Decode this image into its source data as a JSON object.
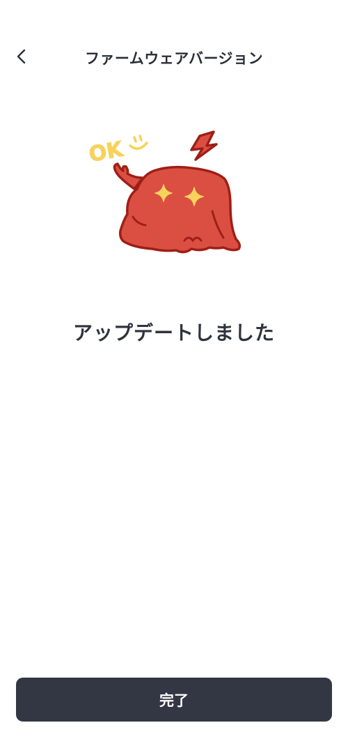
{
  "header": {
    "title": "ファームウェアバージョン",
    "back_icon": "chevron-left-icon"
  },
  "illustration": {
    "icon": "ok-mascot-illustration",
    "text": "OK",
    "colors": {
      "body": "#db4f42",
      "outline": "#9e1f16",
      "stars": "#f6d45c",
      "ok_text": "#f5d25a"
    }
  },
  "main": {
    "message": "アップデートしました"
  },
  "footer": {
    "done_label": "完了"
  },
  "colors": {
    "button_bg": "#333744",
    "button_text": "#ffffff",
    "text": "#2f333c"
  }
}
